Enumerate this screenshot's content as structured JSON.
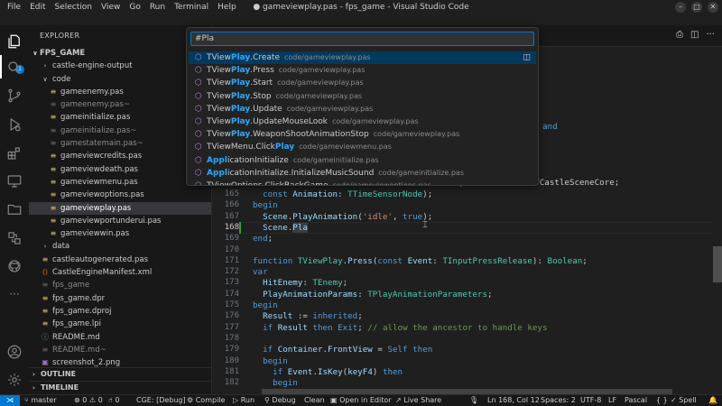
{
  "window": {
    "title": "● gameviewplay.pas - fps_game - Visual Studio Code",
    "menu": [
      "File",
      "Edit",
      "Selection",
      "View",
      "Go",
      "Run",
      "Terminal",
      "Help"
    ],
    "controls": [
      "–",
      "□",
      "✕"
    ]
  },
  "activity": {
    "badge": "1"
  },
  "sidebar": {
    "title": "EXPLORER",
    "more": "···",
    "root": "FPS_GAME",
    "items": [
      {
        "label": "castle-engine-output",
        "kind": "folder",
        "depth": 1,
        "open": false,
        "dim": false
      },
      {
        "label": "code",
        "kind": "folder",
        "depth": 1,
        "open": true,
        "dim": false
      },
      {
        "label": "gameenemy.pas",
        "kind": "file",
        "depth": 2,
        "dim": false
      },
      {
        "label": "gameenemy.pas~",
        "kind": "file",
        "depth": 2,
        "dim": true
      },
      {
        "label": "gameinitialize.pas",
        "kind": "file",
        "depth": 2,
        "dim": false
      },
      {
        "label": "gameinitialize.pas~",
        "kind": "file",
        "depth": 2,
        "dim": true
      },
      {
        "label": "gamestatemain.pas~",
        "kind": "file",
        "depth": 2,
        "dim": true
      },
      {
        "label": "gameviewcredits.pas",
        "kind": "file",
        "depth": 2,
        "dim": false
      },
      {
        "label": "gameviewdeath.pas",
        "kind": "file",
        "depth": 2,
        "dim": false
      },
      {
        "label": "gameviewmenu.pas",
        "kind": "file",
        "depth": 2,
        "dim": false
      },
      {
        "label": "gameviewoptions.pas",
        "kind": "file",
        "depth": 2,
        "dim": false
      },
      {
        "label": "gameviewplay.pas",
        "kind": "file",
        "depth": 2,
        "dim": false,
        "selected": true
      },
      {
        "label": "gameviewportunderui.pas",
        "kind": "file",
        "depth": 2,
        "dim": false
      },
      {
        "label": "gameviewwin.pas",
        "kind": "file",
        "depth": 2,
        "dim": false
      },
      {
        "label": "data",
        "kind": "folder",
        "depth": 1,
        "open": false,
        "dim": false
      },
      {
        "label": "castleautogenerated.pas",
        "kind": "file",
        "depth": 1,
        "dim": false
      },
      {
        "label": "CastleEngineManifest.xml",
        "kind": "xml",
        "depth": 1,
        "dim": false
      },
      {
        "label": "fps_game",
        "kind": "file",
        "depth": 1,
        "dim": true
      },
      {
        "label": "fps_game.dpr",
        "kind": "file",
        "depth": 1,
        "dim": false
      },
      {
        "label": "fps_game.dproj",
        "kind": "file",
        "depth": 1,
        "dim": false
      },
      {
        "label": "fps_game.lpi",
        "kind": "file",
        "depth": 1,
        "dim": false
      },
      {
        "label": "README.md",
        "kind": "info",
        "depth": 1,
        "dim": false
      },
      {
        "label": "README.md~",
        "kind": "file",
        "depth": 1,
        "dim": true
      },
      {
        "label": "screenshot_2.png",
        "kind": "image",
        "depth": 1,
        "dim": false
      }
    ],
    "sections": [
      "OUTLINE",
      "TIMELINE"
    ]
  },
  "quickopen": {
    "query": "#Pla",
    "results": [
      {
        "pre": "TView",
        "match": "Play",
        "post": ".Create",
        "path": "code/gameviewplay.pas",
        "active": true
      },
      {
        "pre": "TView",
        "match": "Play",
        "post": ".Press",
        "path": "code/gameviewplay.pas"
      },
      {
        "pre": "TView",
        "match": "Play",
        "post": ".Start",
        "path": "code/gameviewplay.pas"
      },
      {
        "pre": "TView",
        "match": "Play",
        "post": ".Stop",
        "path": "code/gameviewplay.pas"
      },
      {
        "pre": "TView",
        "match": "Play",
        "post": ".Update",
        "path": "code/gameviewplay.pas"
      },
      {
        "pre": "TView",
        "match": "Play",
        "post": ".UpdateMouseLook",
        "path": "code/gameviewplay.pas"
      },
      {
        "pre": "TView",
        "match": "Play",
        "post": ".WeaponShootAnimationStop",
        "path": "code/gameviewplay.pas"
      },
      {
        "pre": "TViewMenu.Click",
        "match": "Play",
        "post": "",
        "path": "code/gameviewmenu.pas"
      },
      {
        "pre": "",
        "match": "Appl",
        "post": "icationInitialize",
        "path": "code/gameinitialize.pas"
      },
      {
        "pre": "",
        "match": "Appl",
        "post": "icationInitialize.InitializeMusicSound",
        "path": "code/gameinitialize.pas"
      },
      {
        "pre": "TViewOptions.ClickBackGame",
        "match": "",
        "post": "",
        "path": "code/gameviewoptions.pas"
      }
    ]
  },
  "editor": {
    "peek_right": "and",
    "peek_line164": "ationStop(const Scene: TCastleSceneCore;",
    "lines": [
      {
        "n": "165",
        "text": "  const Animation: TTimeSensorNode);"
      },
      {
        "n": "166",
        "text": "begin"
      },
      {
        "n": "167",
        "text": "  Scene.PlayAnimation('idle', true);"
      },
      {
        "n": "168",
        "text": "  Scene.Pla"
      },
      {
        "n": "169",
        "text": "end;"
      },
      {
        "n": "170",
        "text": ""
      },
      {
        "n": "171",
        "text": "function TViewPlay.Press(const Event: TInputPressRelease): Boolean;"
      },
      {
        "n": "172",
        "text": "var"
      },
      {
        "n": "173",
        "text": "  HitEnemy: TEnemy;"
      },
      {
        "n": "174",
        "text": "  PlayAnimationParams: TPlayAnimationParameters;"
      },
      {
        "n": "175",
        "text": "begin"
      },
      {
        "n": "176",
        "text": "  Result := inherited;"
      },
      {
        "n": "177",
        "text": "  if Result then Exit; // allow the ancestor to handle keys"
      },
      {
        "n": "178",
        "text": ""
      },
      {
        "n": "179",
        "text": "  if Container.FrontView = Self then"
      },
      {
        "n": "180",
        "text": "  begin"
      },
      {
        "n": "181",
        "text": "    if Event.IsKey(keyF4) then"
      },
      {
        "n": "182",
        "text": "    begin"
      }
    ]
  },
  "statusbar": {
    "branch": "master",
    "problems": "⊗ 0 ⚠ 0",
    "ports": "⑁ 0",
    "cge": "CGE: [Debug]",
    "compile": "Compile",
    "run": "Run",
    "debug": "Debug",
    "clean": "Clean",
    "open_editor": "Open in Editor",
    "live_share": "Live Share",
    "position": "Ln 168, Col 12",
    "spaces": "Spaces: 2",
    "encoding": "UTF-8",
    "eol": "LF",
    "language": "Pascal",
    "spell": "Spell"
  }
}
